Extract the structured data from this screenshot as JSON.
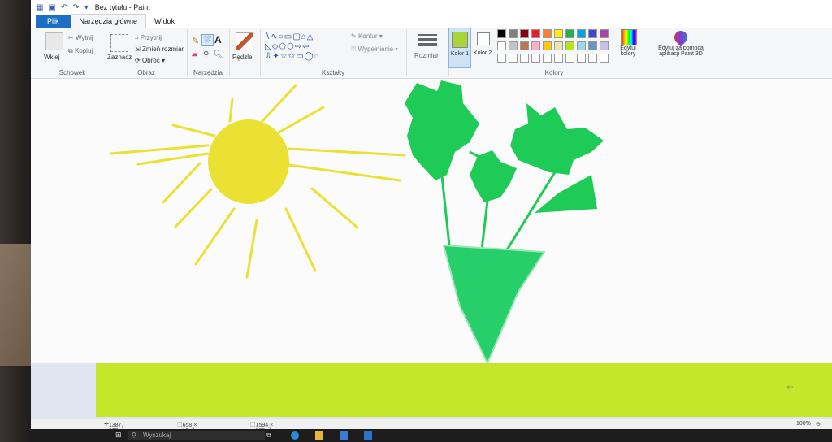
{
  "window": {
    "title": "Bez tytułu - Paint"
  },
  "tabs": {
    "file": "Plik",
    "home": "Narzędzia główne",
    "view": "Widok"
  },
  "clipboard": {
    "paste": "Wklej",
    "cut": "Wytnij",
    "copy": "Kopiuj",
    "label": "Schowek"
  },
  "image": {
    "select": "Zaznacz",
    "crop": "Przytnij",
    "resize": "Zmień rozmiar",
    "rotate": "Obróć",
    "label": "Obraz"
  },
  "tools": {
    "label": "Narzędzia"
  },
  "brushes": {
    "label": "Pędzle"
  },
  "shapes": {
    "outline": "Kontur",
    "fill": "Wypełnienie",
    "label": "Kształty"
  },
  "size": {
    "label": "Rozmiar"
  },
  "colors": {
    "color1": "Kolor 1",
    "color1_value": "#a8d63a",
    "color2": "Kolor 2",
    "color2_value": "#ffffff",
    "edit": "Edytuj kolory",
    "paint3d": "Edytuj za pomocą aplikacji Paint 3D",
    "label": "Kolory",
    "palette": [
      "#000000",
      "#7f7f7f",
      "#880015",
      "#ed1c24",
      "#ff7f27",
      "#fff200",
      "#22b14c",
      "#00a2e8",
      "#3f48cc",
      "#a349a4",
      "#ffffff",
      "#c3c3c3",
      "#b97a57",
      "#ffaec9",
      "#ffc90e",
      "#efe4b0",
      "#b5e61d",
      "#99d9ea",
      "#7092be",
      "#c8bfe7"
    ]
  },
  "status": {
    "cursor": "1387, 603piks.",
    "selection": "658 × 17piks.",
    "canvas_size": "1594 × 720piks.",
    "zoom": "100%"
  },
  "taskbar": {
    "search": "Wyszukaj"
  },
  "drawing": {
    "sky": "#fbfbfb",
    "ground": "#c6e62a",
    "sun": "#ebe133",
    "plant": "#1fcb57",
    "vase": "#27cf6a"
  }
}
